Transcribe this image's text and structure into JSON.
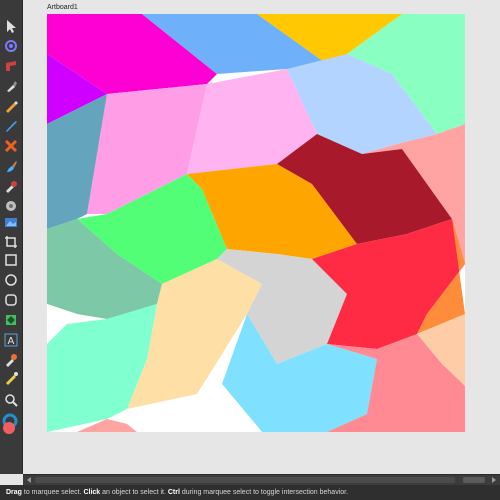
{
  "artboard": {
    "title": "Artboard1"
  },
  "toolbar": {
    "tools": [
      {
        "name": "move-tool-icon",
        "color": "#e0e0e0"
      },
      {
        "name": "context-toolbar-icon",
        "color": "#7a7aff"
      },
      {
        "name": "fill-tool-icon",
        "color": "#d04040"
      },
      {
        "name": "pen-tool-icon",
        "color": "#e0e0e0"
      },
      {
        "name": "pencil-tool-icon",
        "color": "#f0a030"
      },
      {
        "name": "vector-brush-icon",
        "color": "#40a0ff"
      },
      {
        "name": "fill-brush-icon",
        "color": "#f06020"
      },
      {
        "name": "paint-brush-icon",
        "color": "#40b0ff"
      },
      {
        "name": "color-picker-icon",
        "color": "#d04040"
      },
      {
        "name": "transparency-tool-icon",
        "color": "#c0c0c0"
      },
      {
        "name": "place-image-icon",
        "color": "#4080d0"
      },
      {
        "name": "crop-tool-icon",
        "color": "#e0e0e0"
      },
      {
        "name": "rectangle-tool-icon",
        "color": "#e0e0e0"
      },
      {
        "name": "ellipse-tool-icon",
        "color": "#e0e0e0"
      },
      {
        "name": "rounded-rectangle-icon",
        "color": "#e0e0e0"
      },
      {
        "name": "shape-tool-icon",
        "color": "#40c060"
      },
      {
        "name": "artistic-text-icon",
        "color": "#60a0e0"
      },
      {
        "name": "eyedropper-tool-icon",
        "color": "#f07030"
      },
      {
        "name": "gradient-tool-icon",
        "color": "#f0d040"
      },
      {
        "name": "zoom-tool-icon",
        "color": "#e0e0e0"
      }
    ],
    "colors": {
      "primary": "#f06060",
      "secondary": "#2090d0"
    }
  },
  "status": {
    "word1": "Drag",
    "text1": " to marquee select. ",
    "word2": "Click",
    "text2": " an object to select it. ",
    "word3": "Ctrl",
    "text3": " during marquee select to toggle intersection behavior."
  },
  "pattern": {
    "colors": {
      "magenta": "#ff00d4",
      "sky": "#6eb1fa",
      "gold": "#ffc800",
      "mint": "#8affc2",
      "purple": "#cf00ff",
      "pink": "#ff9ee6",
      "lightpink": "#ffb3f0",
      "lightblue": "#b3d4ff",
      "teal": "#64a4bc",
      "green": "#52fe76",
      "orange": "#ffa500",
      "crimson": "#a8192c",
      "salmon": "#ffa3a3",
      "sage": "#7dc8a6",
      "red": "#ff2a43",
      "tangerine": "#ff8c3a",
      "aqua": "#80ffd0",
      "cream": "#fee0a6",
      "gray": "#d4d4d4",
      "peach": "#ffcca8",
      "cyan": "#7fe0ff",
      "coral": "#ff8a93"
    }
  }
}
